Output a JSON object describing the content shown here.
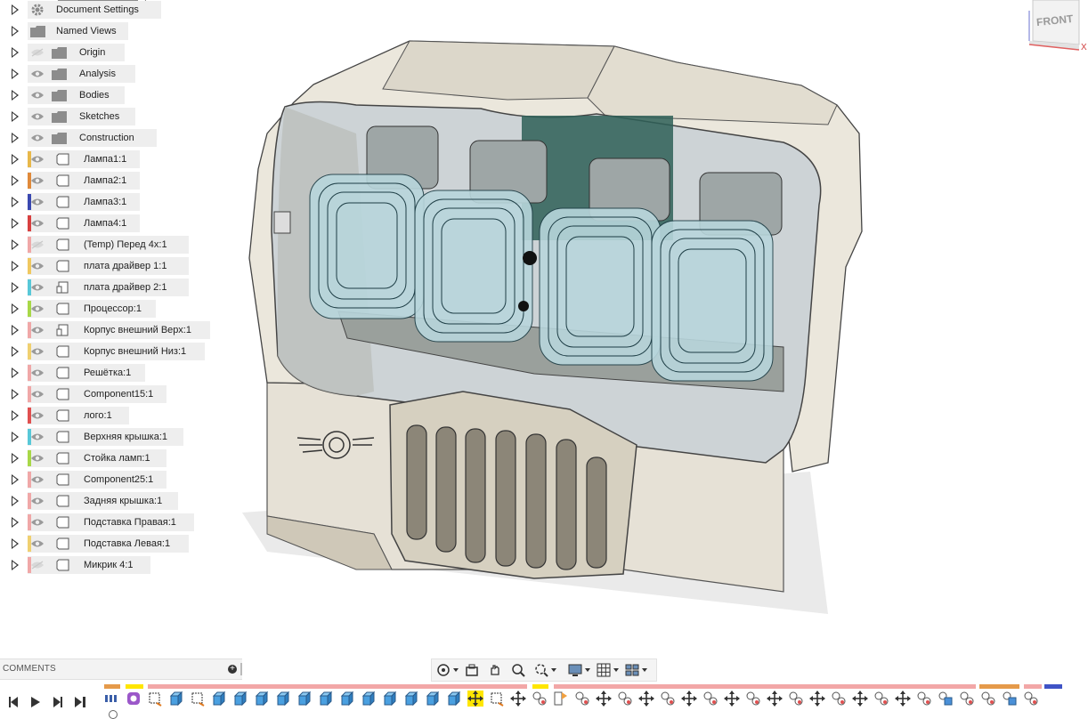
{
  "browser": {
    "items": [
      {
        "label": "Document Settings",
        "kind": "settings",
        "color": "",
        "eye": "none"
      },
      {
        "label": "Named Views",
        "kind": "folder",
        "color": "",
        "eye": "none"
      },
      {
        "label": "Origin",
        "kind": "folder",
        "color": "",
        "eye": "hidden"
      },
      {
        "label": "Analysis",
        "kind": "folder",
        "color": "",
        "eye": "visible"
      },
      {
        "label": "Bodies",
        "kind": "folder",
        "color": "",
        "eye": "visible"
      },
      {
        "label": "Sketches",
        "kind": "folder",
        "color": "",
        "eye": "visible"
      },
      {
        "label": "Construction",
        "kind": "folder",
        "color": "",
        "eye": "visible"
      },
      {
        "label": "Лампа1:1",
        "kind": "component",
        "color": "#e8b84a",
        "eye": "visible"
      },
      {
        "label": "Лампа2:1",
        "kind": "component",
        "color": "#e08a3a",
        "eye": "visible"
      },
      {
        "label": "Лампа3:1",
        "kind": "component",
        "color": "#3a48b0",
        "eye": "visible"
      },
      {
        "label": "Лампа4:1",
        "kind": "component",
        "color": "#d84040",
        "eye": "visible"
      },
      {
        "label": "(Temp) Перед 4x:1",
        "kind": "component",
        "color": "#f0a8a8",
        "eye": "hidden"
      },
      {
        "label": "плата драйвер 1:1",
        "kind": "component",
        "color": "#f0c860",
        "eye": "visible"
      },
      {
        "label": "плата драйвер 2:1",
        "kind": "component-linked",
        "color": "#58c8d8",
        "eye": "visible"
      },
      {
        "label": "Процессор:1",
        "kind": "component",
        "color": "#a8d848",
        "eye": "visible"
      },
      {
        "label": "Корпус внешний Верх:1",
        "kind": "component-linked",
        "color": "#f0a8a8",
        "eye": "visible"
      },
      {
        "label": "Корпус внешний Низ:1",
        "kind": "component",
        "color": "#f0d070",
        "eye": "visible"
      },
      {
        "label": "Решётка:1",
        "kind": "component",
        "color": "#f0a8a8",
        "eye": "visible"
      },
      {
        "label": "Component15:1",
        "kind": "component",
        "color": "#f0a8a8",
        "eye": "visible"
      },
      {
        "label": "лого:1",
        "kind": "component",
        "color": "#e05050",
        "eye": "visible"
      },
      {
        "label": "Верхняя крышка:1",
        "kind": "component",
        "color": "#58c8d8",
        "eye": "visible"
      },
      {
        "label": "Стойка ламп:1",
        "kind": "component",
        "color": "#a8d848",
        "eye": "visible"
      },
      {
        "label": "Component25:1",
        "kind": "component",
        "color": "#f0a8a8",
        "eye": "visible"
      },
      {
        "label": "Задняя крышка:1",
        "kind": "component",
        "color": "#f0a8a8",
        "eye": "visible"
      },
      {
        "label": "Подставка Правая:1",
        "kind": "component",
        "color": "#f0a8a8",
        "eye": "visible"
      },
      {
        "label": "Подставка Левая:1",
        "kind": "component",
        "color": "#f0d070",
        "eye": "visible"
      },
      {
        "label": "Микрик 4:1",
        "kind": "component",
        "color": "#f0a8a8",
        "eye": "hidden"
      }
    ]
  },
  "viewcube": {
    "face_label": "FRONT",
    "axis_label": "X"
  },
  "comments": {
    "label": "COMMENTS"
  },
  "navigation": {
    "tools": [
      "orbit-icon",
      "look-at-icon",
      "pan-icon",
      "zoom-icon",
      "fit-icon",
      "display-settings-icon",
      "grid-icon",
      "viewports-icon"
    ]
  },
  "timeline": {
    "controls": [
      "step-back-icon",
      "play-icon",
      "step-forward-icon",
      "go-to-end-icon"
    ],
    "feature_count": 44
  },
  "colors": {
    "panel_bg": "#eeeeee",
    "accent": "#ffe600",
    "timeline_orange": "#e59a4a",
    "timeline_pink": "#f2a7a7",
    "timeline_blue": "#3f53c6"
  }
}
